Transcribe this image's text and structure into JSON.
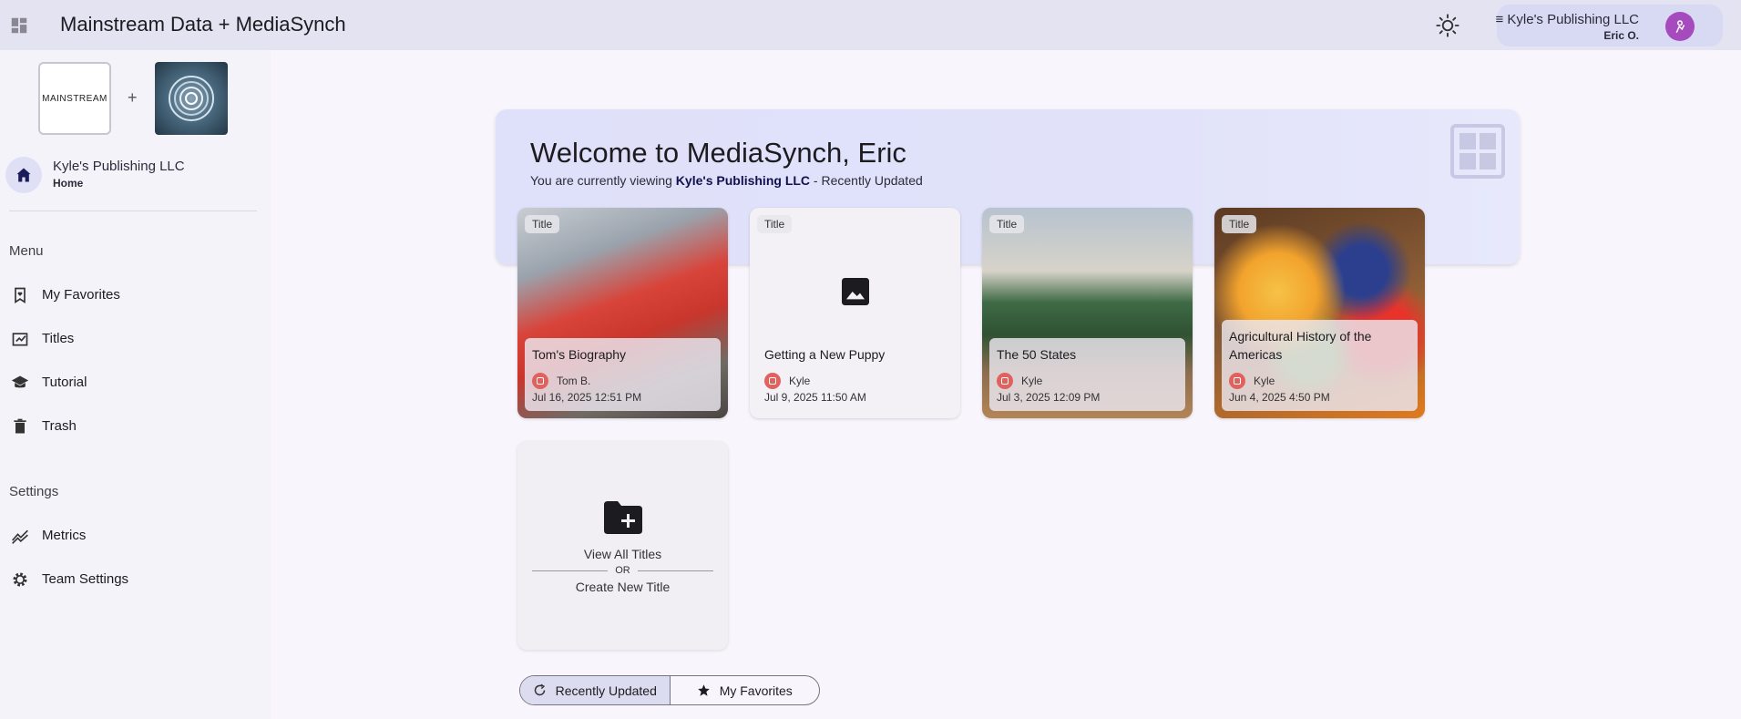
{
  "header": {
    "app_title": "Mainstream Data + MediaSynch",
    "account_org": "≡ Kyle's Publishing LLC",
    "account_user": "Eric O."
  },
  "sidebar": {
    "logo_left_text": "MAINSTREAM",
    "logo_plus": "+",
    "home": {
      "org": "Kyle's Publishing LLC",
      "label": "Home"
    },
    "menu_label": "Menu",
    "menu_items": [
      {
        "label": "My Favorites",
        "icon": "bookmark-heart-icon"
      },
      {
        "label": "Titles",
        "icon": "titles-icon"
      },
      {
        "label": "Tutorial",
        "icon": "school-icon"
      },
      {
        "label": "Trash",
        "icon": "trash-icon"
      }
    ],
    "settings_label": "Settings",
    "settings_items": [
      {
        "label": "Metrics",
        "icon": "metrics-icon"
      },
      {
        "label": "Team Settings",
        "icon": "gear-icon"
      }
    ]
  },
  "banner": {
    "welcome": "Welcome to MediaSynch, Eric",
    "viewing_prefix": "You are currently viewing ",
    "viewing_org": "Kyle's Publishing LLC",
    "viewing_suffix": " - Recently Updated"
  },
  "cards": [
    {
      "tag": "Title",
      "title": "Tom's Biography",
      "owner": "Tom B.",
      "date": "Jul 16, 2025 12:51 PM"
    },
    {
      "tag": "Title",
      "title": "Getting a New Puppy",
      "owner": "Kyle",
      "date": "Jul 9, 2025 11:50 AM"
    },
    {
      "tag": "Title",
      "title": "The 50 States",
      "owner": "Kyle",
      "date": "Jul 3, 2025 12:09 PM"
    },
    {
      "tag": "Title",
      "title": "Agricultural History of the Americas",
      "owner": "Kyle",
      "date": "Jun 4, 2025 4:50 PM"
    }
  ],
  "new_card": {
    "view_all": "View All Titles",
    "or": "OR",
    "create_new": "Create New Title"
  },
  "toggle": {
    "recent": "Recently Updated",
    "favorites": "My Favorites"
  },
  "colors": {
    "topbar": "#e3e3f1",
    "banner": "#dfe0f9",
    "avatar": "#a64bbd",
    "owner_badge": "#e0625f"
  }
}
